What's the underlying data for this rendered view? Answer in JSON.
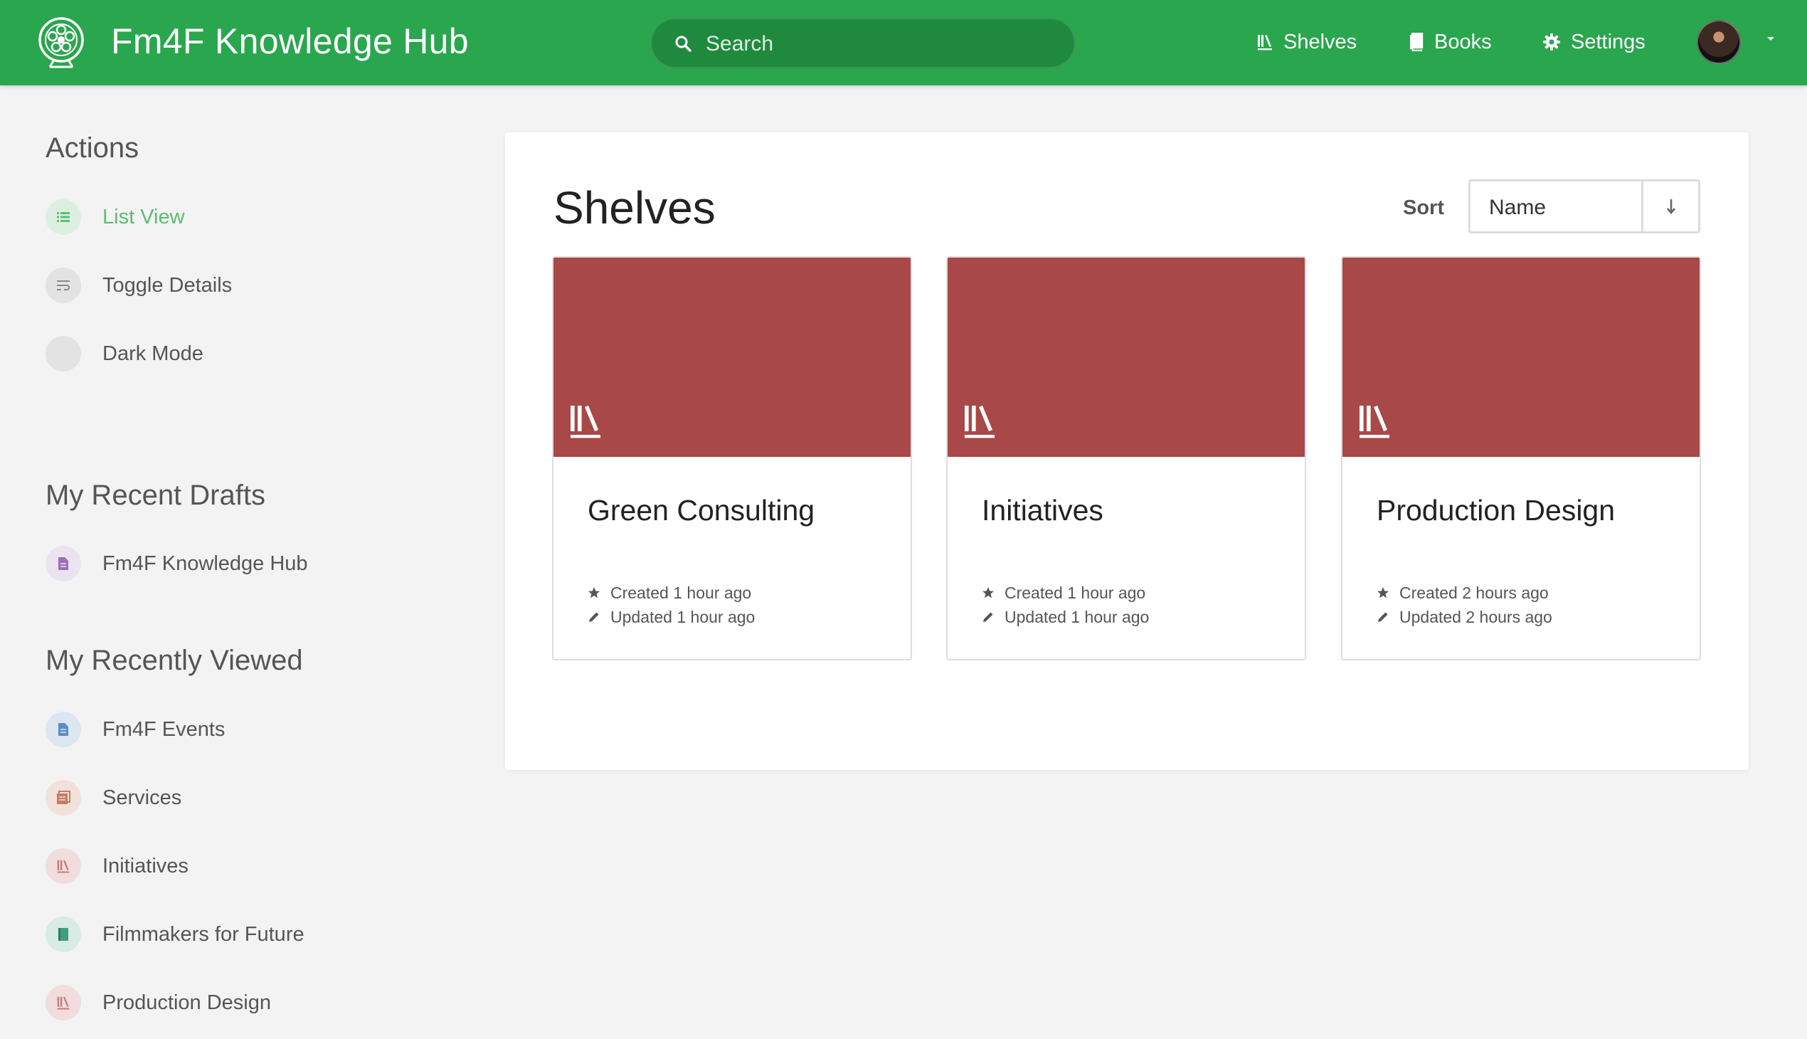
{
  "header": {
    "title": "Fm4F Knowledge Hub",
    "search_placeholder": "Search",
    "nav": {
      "shelves": "Shelves",
      "books": "Books",
      "settings": "Settings"
    },
    "accent": "#2aa64e"
  },
  "sidebar": {
    "actions_heading": "Actions",
    "actions": [
      {
        "label": "List View",
        "icon": "list-icon",
        "active": true
      },
      {
        "label": "Toggle Details",
        "icon": "details-icon"
      },
      {
        "label": "Dark Mode",
        "icon": "moon-icon"
      }
    ],
    "drafts_heading": "My Recent Drafts",
    "drafts": [
      {
        "label": "Fm4F Knowledge Hub",
        "icon": "page-icon"
      }
    ],
    "viewed_heading": "My Recently Viewed",
    "viewed": [
      {
        "label": "Fm4F Events",
        "icon": "page-icon"
      },
      {
        "label": "Services",
        "icon": "chapter-icon"
      },
      {
        "label": "Initiatives",
        "icon": "shelf-icon"
      },
      {
        "label": "Filmmakers for Future",
        "icon": "book-icon"
      },
      {
        "label": "Production Design",
        "icon": "shelf-icon"
      }
    ]
  },
  "main": {
    "title": "Shelves",
    "sort_label": "Sort",
    "sort_value": "Name",
    "cover_color": "#a94848",
    "shelves": [
      {
        "name": "Green Consulting",
        "created": "Created 1 hour ago",
        "updated": "Updated 1 hour ago"
      },
      {
        "name": "Initiatives",
        "created": "Created 1 hour ago",
        "updated": "Updated 1 hour ago"
      },
      {
        "name": "Production Design",
        "created": "Created 2 hours ago",
        "updated": "Updated 2 hours ago"
      }
    ]
  }
}
